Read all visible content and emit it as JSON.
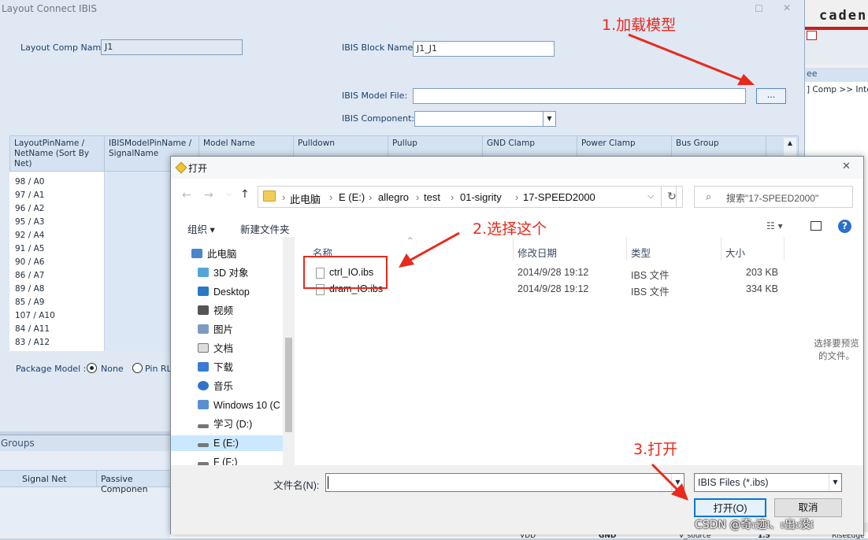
{
  "bg_window": {
    "title": "Layout Connect IBIS",
    "comp_name_label": "Layout Comp Name:",
    "comp_name_value": "J1",
    "block_name_label": "IBIS Block Name:",
    "block_name_value": "J1_J1",
    "model_file_label": "IBIS Model File:",
    "model_file_value": "",
    "browse_label": "...",
    "component_label": "IBIS Component:",
    "columns": [
      "LayoutPinName / NetName (Sort By Net)",
      "IBISModelPinName / SignalName",
      "Model Name",
      "Pulldown",
      "Pullup",
      "GND Clamp",
      "Power Clamp",
      "Bus Group"
    ],
    "pins": [
      "98 / A0",
      "97 / A1",
      "96 / A2",
      "95 / A3",
      "92 / A4",
      "91 / A5",
      "90 / A6",
      "86 / A7",
      "89 / A8",
      "85 / A9",
      "107 / A10",
      "84 / A11",
      "83 / A12"
    ],
    "package_model_label": "Package Model :",
    "pkg_none": "None",
    "pkg_pin_rl": "Pin RL",
    "groups_title": "Groups",
    "groups_cols": [
      "Signal Net",
      "Passive Componen"
    ],
    "bottom_cells": [
      "VDD",
      "GND",
      "V_source",
      "1.5",
      "RiseEdge"
    ]
  },
  "right_panel": {
    "brand": "caden",
    "tab": "ee",
    "breadcrumb": "] Comp >> Inter"
  },
  "dialog": {
    "title": "打开",
    "breadcrumb": [
      "此电脑",
      "E (E:)",
      "allegro",
      "test",
      "01-sigrity",
      "17-SPEED2000"
    ],
    "search_placeholder": "搜索\"17-SPEED2000\"",
    "toolbar": {
      "organize": "组织",
      "new_folder": "新建文件夹"
    },
    "tree": [
      "此电脑",
      "3D 对象",
      "Desktop",
      "视频",
      "图片",
      "文档",
      "下载",
      "音乐",
      "Windows 10 (C",
      "学习 (D:)",
      "E (E:)",
      "F (F:)"
    ],
    "columns": {
      "name": "名称",
      "modified": "修改日期",
      "type": "类型",
      "size": "大小"
    },
    "files": [
      {
        "name": "ctrl_IO.ibs",
        "modified": "2014/9/28 19:12",
        "type": "IBS 文件",
        "size": "203 KB"
      },
      {
        "name": "dram_IO.ibs",
        "modified": "2014/9/28 19:12",
        "type": "IBS 文件",
        "size": "334 KB"
      }
    ],
    "preview_text": "选择要预览的文件。",
    "filename_label": "文件名(N):",
    "filename_value": "",
    "filter_value": "IBIS Files (*.ibs)",
    "open_button": "打开(O)",
    "cancel_button": "取消"
  },
  "annotations": {
    "step1": "1.加载模型",
    "step2": "2.选择这个",
    "step3": "3.打开",
    "watermark": "CSDN @奇𝔯迹𝔩、𝔯出𝔯没𝔩"
  },
  "colors": {
    "annotation_red": "#e8291d",
    "header_blue": "#d5e2f1",
    "selection": "#cce8ff"
  }
}
